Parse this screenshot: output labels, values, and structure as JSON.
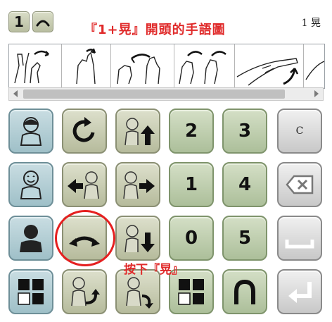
{
  "top_keys": [
    {
      "label": "1"
    },
    {
      "icon": "arch-icon"
    }
  ],
  "title": "『1+晃』開頭的手語圖",
  "counter": "1 晃",
  "sign_strip": {
    "cards": [
      "sign-image-1",
      "sign-image-2",
      "sign-image-3",
      "sign-image-4",
      "sign-image-5",
      "sign-image-6"
    ]
  },
  "keyboard": {
    "row1": {
      "k4": "2",
      "k5": "3",
      "k6": "C"
    },
    "row2": {
      "k4": "1",
      "k5": "4"
    },
    "row3": {
      "k4": "0",
      "k5": "5"
    }
  },
  "annotation": {
    "press_label": "按下『晃』"
  },
  "colors": {
    "annotation_red": "#e02a2a",
    "key_blue": "#9fc0c8",
    "key_olive": "#b6bb9c",
    "key_green": "#acbf9a",
    "key_gray": "#c8c8c8"
  }
}
